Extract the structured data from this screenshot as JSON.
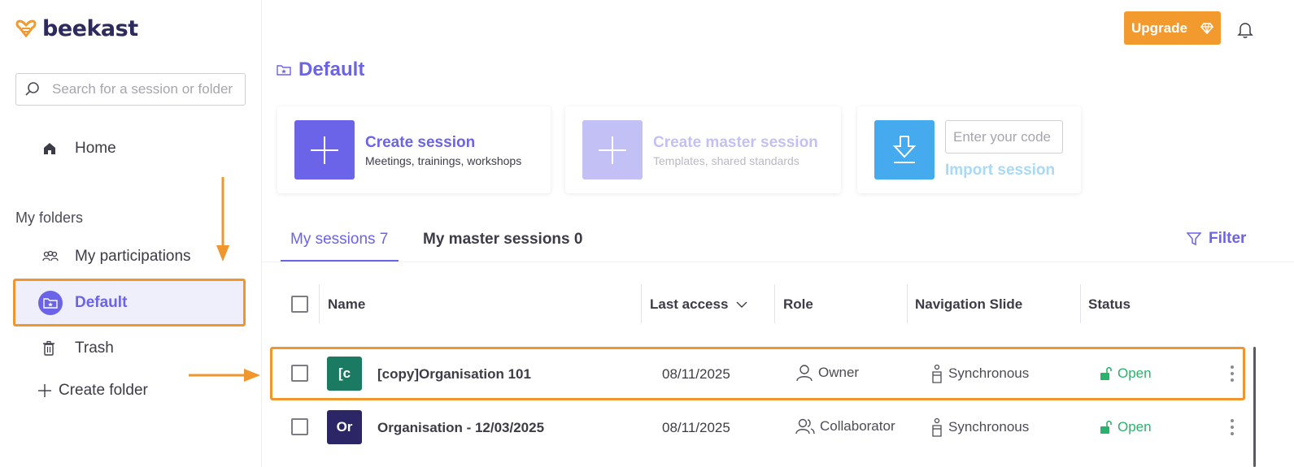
{
  "app": {
    "logo_text": "beekast"
  },
  "sidebar": {
    "search_placeholder": "Search for a session or folder",
    "home_label": "Home",
    "section_label": "My folders",
    "participations_label": "My participations",
    "default_label": "Default",
    "trash_label": "Trash",
    "create_folder_label": "Create folder"
  },
  "header": {
    "upgrade_label": "Upgrade",
    "page_title": "Default"
  },
  "cards": {
    "create": {
      "title": "Create session",
      "subtitle": "Meetings, trainings, workshops"
    },
    "master": {
      "title": "Create master session",
      "subtitle": "Templates, shared standards"
    },
    "import": {
      "code_placeholder": "Enter your code",
      "link_label": "Import session"
    }
  },
  "tabs": {
    "my_sessions": "My sessions 7",
    "master_sessions": "My master sessions 0",
    "filter_label": "Filter"
  },
  "table": {
    "columns": [
      "Name",
      "Last access",
      "Role",
      "Navigation Slide",
      "Status"
    ],
    "rows": [
      {
        "initials": "[c",
        "name": "[copy]Organisation 101",
        "last_access": "08/11/2025",
        "role": "Owner",
        "navigation": "Synchronous",
        "status": "Open",
        "avatar_color": "#1b7a62"
      },
      {
        "initials": "Or",
        "name": "Organisation - 12/03/2025",
        "last_access": "08/11/2025",
        "role": "Collaborator",
        "navigation": "Synchronous",
        "status": "Open",
        "avatar_color": "#2b2767"
      }
    ]
  },
  "colors": {
    "accent": "#6b63e8",
    "brand_orange": "#f39a2e",
    "highlight_orange": "#f0962d",
    "status_green": "#27b36b",
    "import_blue": "#46aaef"
  }
}
